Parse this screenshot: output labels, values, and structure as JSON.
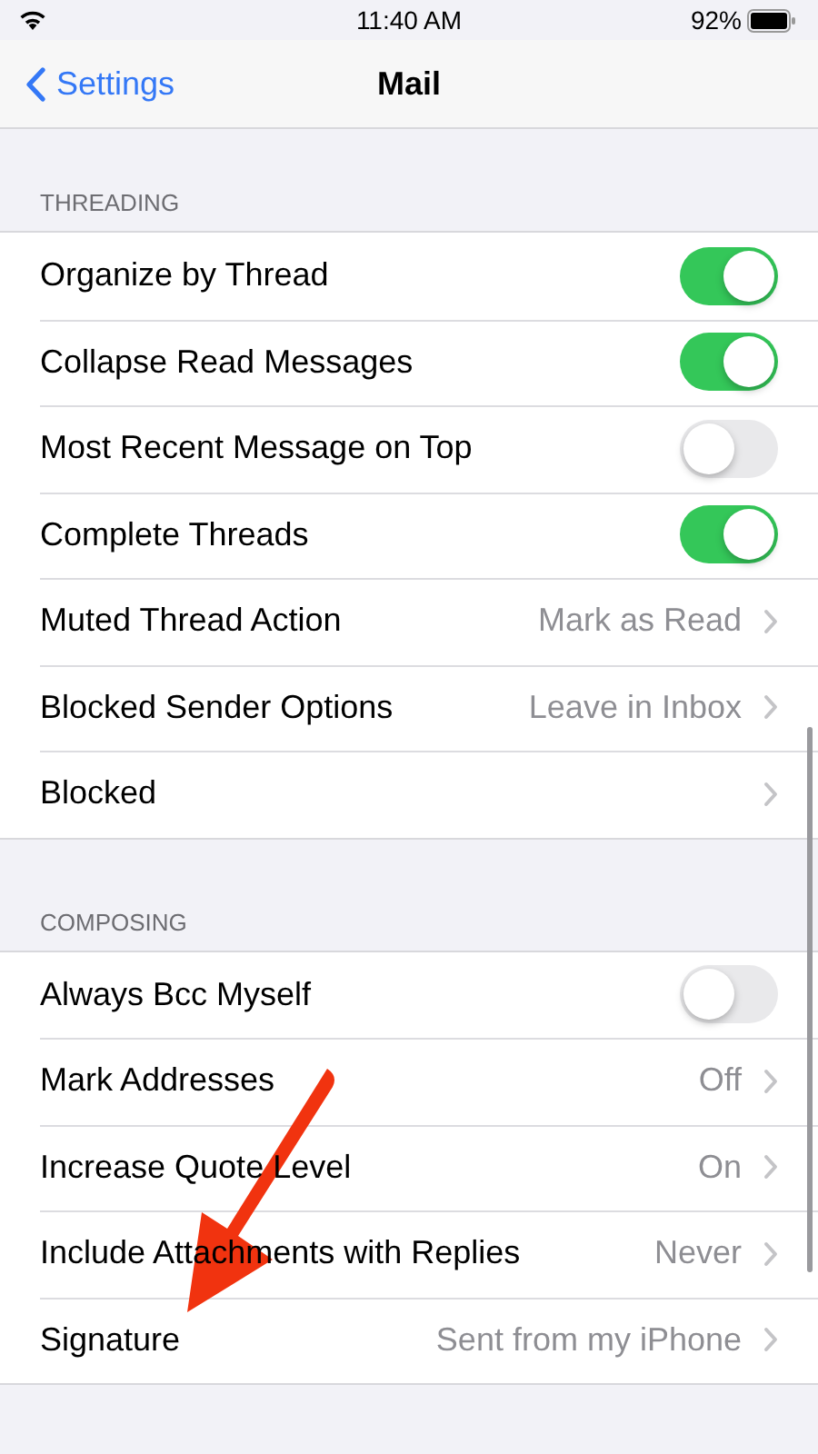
{
  "status_bar": {
    "time": "11:40 AM",
    "battery": "92%"
  },
  "nav": {
    "back": "Settings",
    "title": "Mail"
  },
  "sections": [
    {
      "header": "THREADING",
      "rows": [
        {
          "kind": "toggle",
          "label": "Organize by Thread",
          "on": true
        },
        {
          "kind": "toggle",
          "label": "Collapse Read Messages",
          "on": true
        },
        {
          "kind": "toggle",
          "label": "Most Recent Message on Top",
          "on": false
        },
        {
          "kind": "toggle",
          "label": "Complete Threads",
          "on": true
        },
        {
          "kind": "value",
          "label": "Muted Thread Action",
          "value": "Mark as Read"
        },
        {
          "kind": "value",
          "label": "Blocked Sender Options",
          "value": "Leave in Inbox"
        },
        {
          "kind": "link",
          "label": "Blocked"
        }
      ]
    },
    {
      "header": "COMPOSING",
      "rows": [
        {
          "kind": "toggle",
          "label": "Always Bcc Myself",
          "on": false
        },
        {
          "kind": "value",
          "label": "Mark Addresses",
          "value": "Off"
        },
        {
          "kind": "value",
          "label": "Increase Quote Level",
          "value": "On"
        },
        {
          "kind": "value",
          "label": "Include Attachments with Replies",
          "value": "Never"
        },
        {
          "kind": "value",
          "label": "Signature",
          "value": "Sent from my iPhone"
        }
      ]
    }
  ]
}
